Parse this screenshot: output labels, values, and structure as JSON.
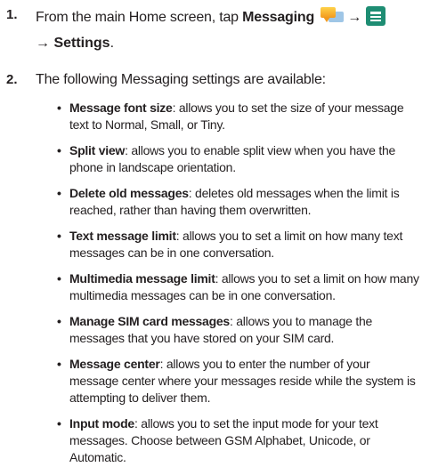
{
  "step1": {
    "number": "1.",
    "text_before": "From the main Home screen, tap ",
    "bold_messaging": "Messaging",
    "messaging_icon": "messaging-app-icon",
    "arrow1": "→",
    "menu_icon": "menu-key-icon",
    "arrow2": "→",
    "bold_settings": "Settings",
    "period": "."
  },
  "step2": {
    "number": "2.",
    "text": "The following Messaging settings are available:"
  },
  "settings": [
    {
      "term": "Message font size",
      "desc": ": allows you to set the size of your message text to Normal, Small, or Tiny."
    },
    {
      "term": "Split view",
      "desc": ": allows you to enable split view when you have the phone in landscape orientation."
    },
    {
      "term": "Delete old messages",
      "desc": ": deletes old messages when the limit is reached, rather than having them overwritten."
    },
    {
      "term": "Text message limit",
      "desc": ": allows you to set a limit on how many text messages can be in one conversation."
    },
    {
      "term": "Multimedia message limit",
      "desc": ": allows you to set a limit on how many multimedia messages can be in one conversation."
    },
    {
      "term": "Manage SIM card messages",
      "desc": ": allows you to manage the messages that you have stored on your SIM card."
    },
    {
      "term": "Message center",
      "desc": ": allows you to enter the number of your message center where your messages reside while the system is attempting to deliver them."
    },
    {
      "term": "Input mode",
      "desc": ": allows you to set the input mode for your text messages. Choose between GSM Alphabet, Unicode, or Automatic."
    }
  ],
  "colors": {
    "text": "#231f20",
    "menu_icon_bg": "#1e8d73",
    "messaging_icon_front": "#f29a1e",
    "messaging_icon_back": "#9fc6e6"
  }
}
